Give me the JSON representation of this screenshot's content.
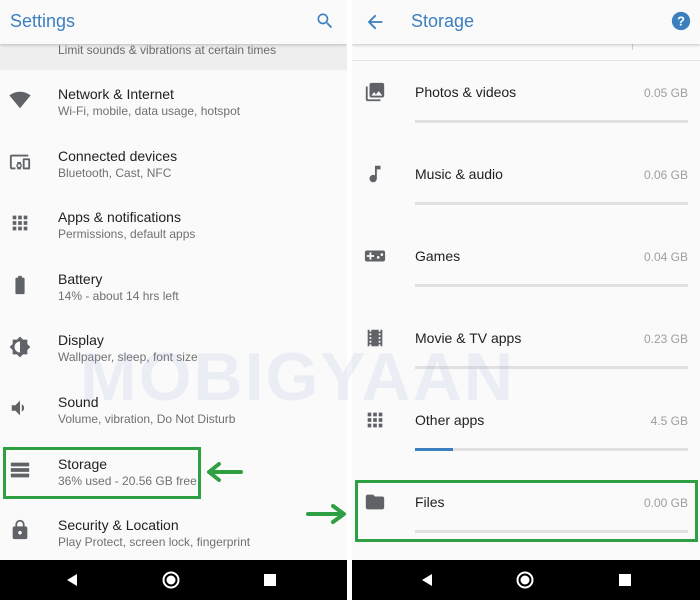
{
  "colors": {
    "accent": "#3b7fbf",
    "highlight": "#2ea043",
    "icon": "#5f6368",
    "nav_bar": "#000000",
    "bar_track": "#e0e0e0"
  },
  "watermark": "MOBIGYAAN",
  "settings": {
    "title": "Settings",
    "search_icon": "search-icon",
    "partial_item": "Limit sounds & vibrations at certain times",
    "items": [
      {
        "icon": "wifi-icon",
        "title": "Network & Internet",
        "subtitle": "Wi-Fi, mobile, data usage, hotspot"
      },
      {
        "icon": "devices-icon",
        "title": "Connected devices",
        "subtitle": "Bluetooth, Cast, NFC"
      },
      {
        "icon": "apps-grid-icon",
        "title": "Apps & notifications",
        "subtitle": "Permissions, default apps"
      },
      {
        "icon": "battery-icon",
        "title": "Battery",
        "subtitle": "14% - about 14 hrs left"
      },
      {
        "icon": "brightness-icon",
        "title": "Display",
        "subtitle": "Wallpaper, sleep, font size"
      },
      {
        "icon": "volume-icon",
        "title": "Sound",
        "subtitle": "Volume, vibration, Do Not Disturb"
      },
      {
        "icon": "storage-icon",
        "title": "Storage",
        "subtitle": "36% used - 20.56 GB free"
      },
      {
        "icon": "lock-icon",
        "title": "Security & Location",
        "subtitle": "Play Protect, screen lock, fingerprint"
      }
    ]
  },
  "storage": {
    "title": "Storage",
    "back_icon": "back-arrow-icon",
    "help_icon": "help-icon",
    "items": [
      {
        "icon": "photo-icon",
        "title": "Photos & videos",
        "size": "0.05 GB",
        "fill_fraction": 0.0
      },
      {
        "icon": "music-note-icon",
        "title": "Music & audio",
        "size": "0.06 GB",
        "fill_fraction": 0.0
      },
      {
        "icon": "gamepad-icon",
        "title": "Games",
        "size": "0.04 GB",
        "fill_fraction": 0.0
      },
      {
        "icon": "movie-icon",
        "title": "Movie & TV apps",
        "size": "0.23 GB",
        "fill_fraction": 0.0
      },
      {
        "icon": "apps-grid-icon",
        "title": "Other apps",
        "size": "4.5 GB",
        "fill_fraction": 0.14
      },
      {
        "icon": "folder-icon",
        "title": "Files",
        "size": "0.00 GB",
        "fill_fraction": 0.0
      }
    ]
  },
  "nav": {
    "back": "nav-back-icon",
    "home": "nav-home-icon",
    "recents": "nav-recents-icon"
  }
}
